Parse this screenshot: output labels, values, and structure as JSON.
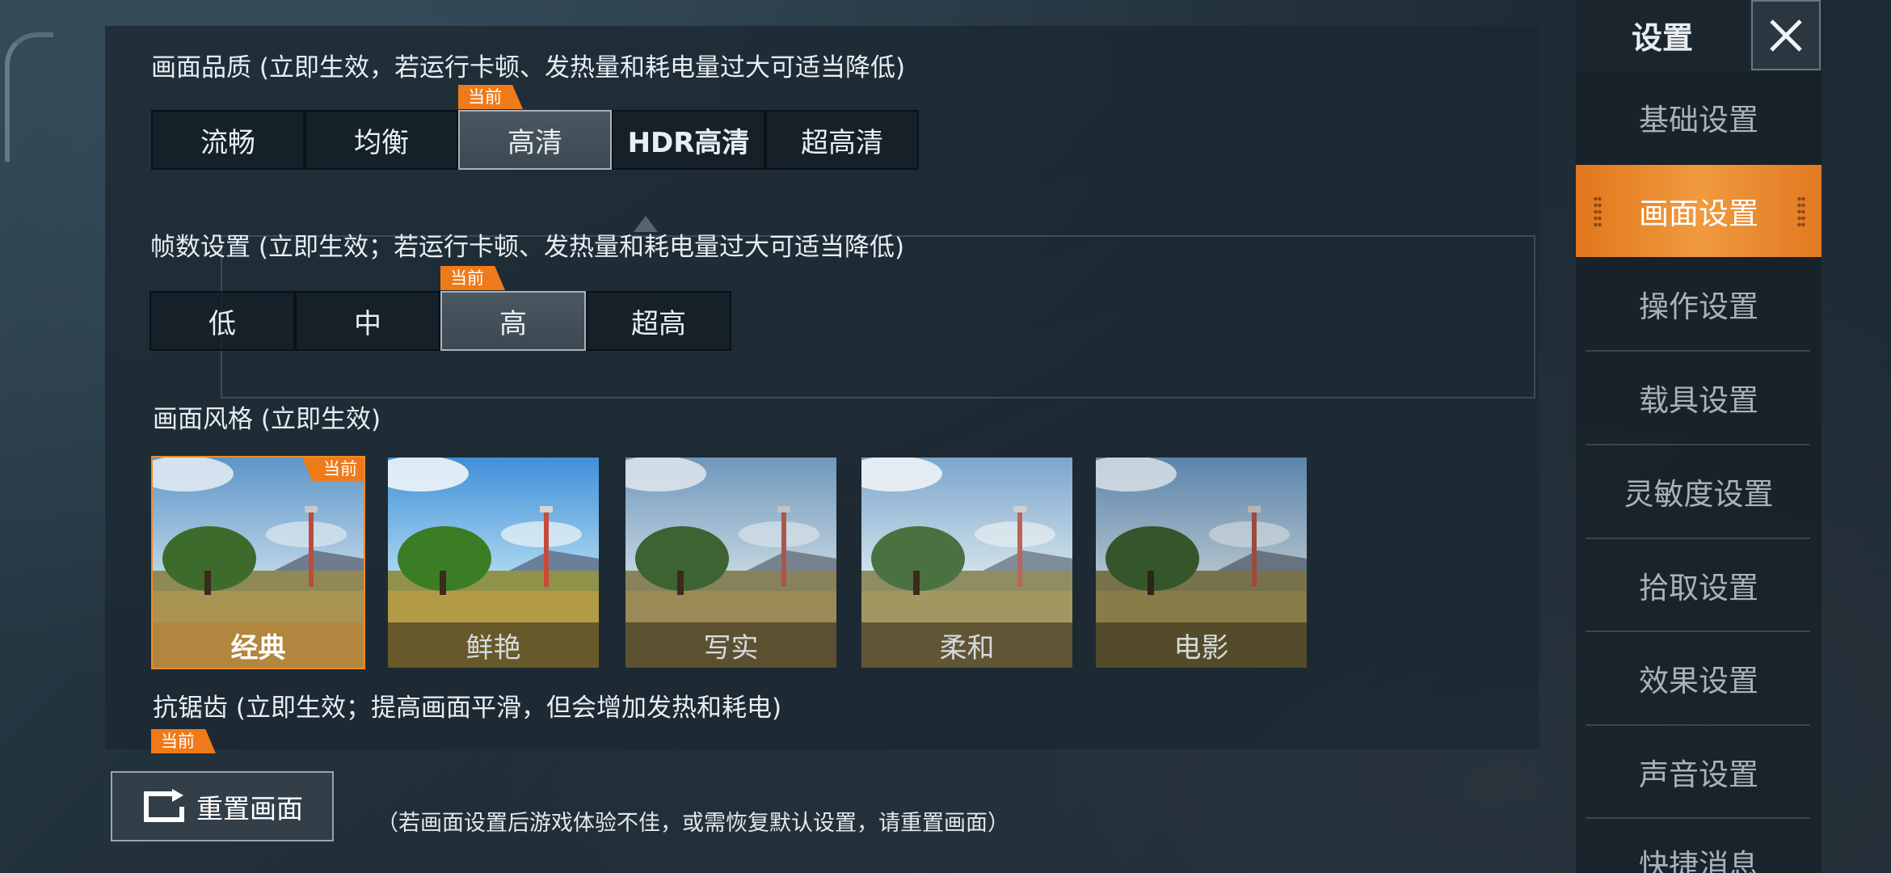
{
  "quality": {
    "title": "画面品质 (立即生效，若运行卡顿、发热量和耗电量过大可适当降低)",
    "options": [
      "流畅",
      "均衡",
      "高清",
      "HDR高清",
      "超高清"
    ],
    "selected": "高清",
    "current_tag": "当前"
  },
  "fps": {
    "title": "帧数设置 (立即生效；若运行卡顿、发热量和耗电量过大可适当降低)",
    "options": [
      "低",
      "中",
      "高",
      "超高"
    ],
    "selected": "高",
    "current_tag": "当前"
  },
  "style": {
    "title": "画面风格 (立即生效)",
    "options": [
      "经典",
      "鲜艳",
      "写实",
      "柔和",
      "电影"
    ],
    "selected": "经典",
    "current_tag": "当前"
  },
  "antialias": {
    "title": "抗锯齿 (立即生效；提高画面平滑，但会增加发热和耗电)",
    "current_tag": "当前"
  },
  "reset": {
    "label": "重置画面",
    "note": "（若画面设置后游戏体验不佳，或需恢复默认设置，请重置画面）"
  },
  "sidebar": {
    "title": "设置",
    "items": [
      "基础设置",
      "画面设置",
      "操作设置",
      "载具设置",
      "灵敏度设置",
      "拾取设置",
      "效果设置",
      "声音设置",
      "快捷消息"
    ],
    "active": "画面设置"
  },
  "colors": {
    "accent": "#ef7a1a",
    "panel": "#1c2832"
  },
  "icons": {
    "close": "close-icon",
    "reset": "reset-icon"
  }
}
